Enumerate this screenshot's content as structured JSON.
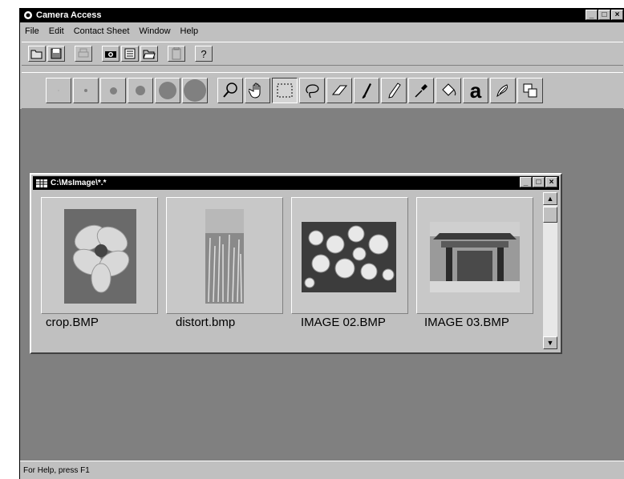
{
  "app": {
    "title": "Camera Access"
  },
  "menu": {
    "items": [
      "File",
      "Edit",
      "Contact Sheet",
      "Window",
      "Help"
    ]
  },
  "toolbar": {
    "buttons": [
      "open-icon",
      "save-icon",
      "print-disabled-icon",
      "camera-icon",
      "contact-sheet-icon",
      "open-folder-icon",
      "clipboard-icon",
      "help-icon"
    ],
    "help_glyph": "?"
  },
  "tools": {
    "brush_sizes": [
      "brush-size-1",
      "brush-size-2",
      "brush-size-3",
      "brush-size-4",
      "brush-size-5",
      "brush-size-6"
    ],
    "items": [
      "zoom-icon",
      "hand-icon",
      "rectangle-select-icon",
      "lasso-icon",
      "eraser-icon",
      "brush-icon",
      "pencil-icon",
      "eyedropper-icon",
      "fill-icon",
      "text-icon",
      "stamp-icon",
      "layers-icon"
    ],
    "text_glyph": "a"
  },
  "child_window": {
    "title": "C:\\MsImage\\*.*",
    "thumbnails": [
      {
        "name": "crop.BMP"
      },
      {
        "name": "distort.bmp"
      },
      {
        "name": "IMAGE 02.BMP"
      },
      {
        "name": "IMAGE 03.BMP"
      }
    ]
  },
  "status": {
    "text": "For Help, press F1"
  },
  "colors": {
    "workspace": "#808080",
    "chrome": "#c0c0c0",
    "titlebar": "#000000"
  }
}
